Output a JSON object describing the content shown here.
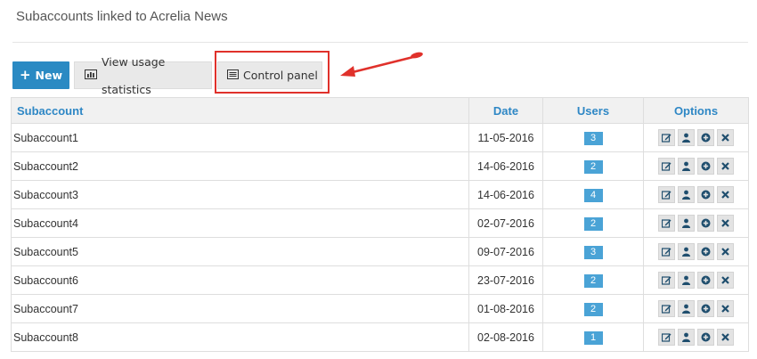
{
  "page": {
    "title": "Subaccounts linked to Acrelia News"
  },
  "toolbar": {
    "new_label": "New",
    "stats_label": "View usage statistics",
    "control_panel_label": "Control panel"
  },
  "table": {
    "headers": {
      "subaccount": "Subaccount",
      "date": "Date",
      "users": "Users",
      "options": "Options"
    },
    "rows": [
      {
        "name": "Subaccount1",
        "date": "11-05-2016",
        "users": "3"
      },
      {
        "name": "Subaccount2",
        "date": "14-06-2016",
        "users": "2"
      },
      {
        "name": "Subaccount3",
        "date": "14-06-2016",
        "users": "4"
      },
      {
        "name": "Subaccount4",
        "date": "02-07-2016",
        "users": "2"
      },
      {
        "name": "Subaccount5",
        "date": "09-07-2016",
        "users": "3"
      },
      {
        "name": "Subaccount6",
        "date": "23-07-2016",
        "users": "2"
      },
      {
        "name": "Subaccount7",
        "date": "01-08-2016",
        "users": "2"
      },
      {
        "name": "Subaccount8",
        "date": "02-08-2016",
        "users": "1"
      }
    ],
    "option_icons": [
      "edit-icon",
      "user-icon",
      "add-circle-icon",
      "delete-icon"
    ]
  },
  "colors": {
    "accent": "#2a8ac3",
    "badge": "#4aa3d6",
    "highlight": "#e0312b",
    "header_text": "#2e87c5"
  }
}
